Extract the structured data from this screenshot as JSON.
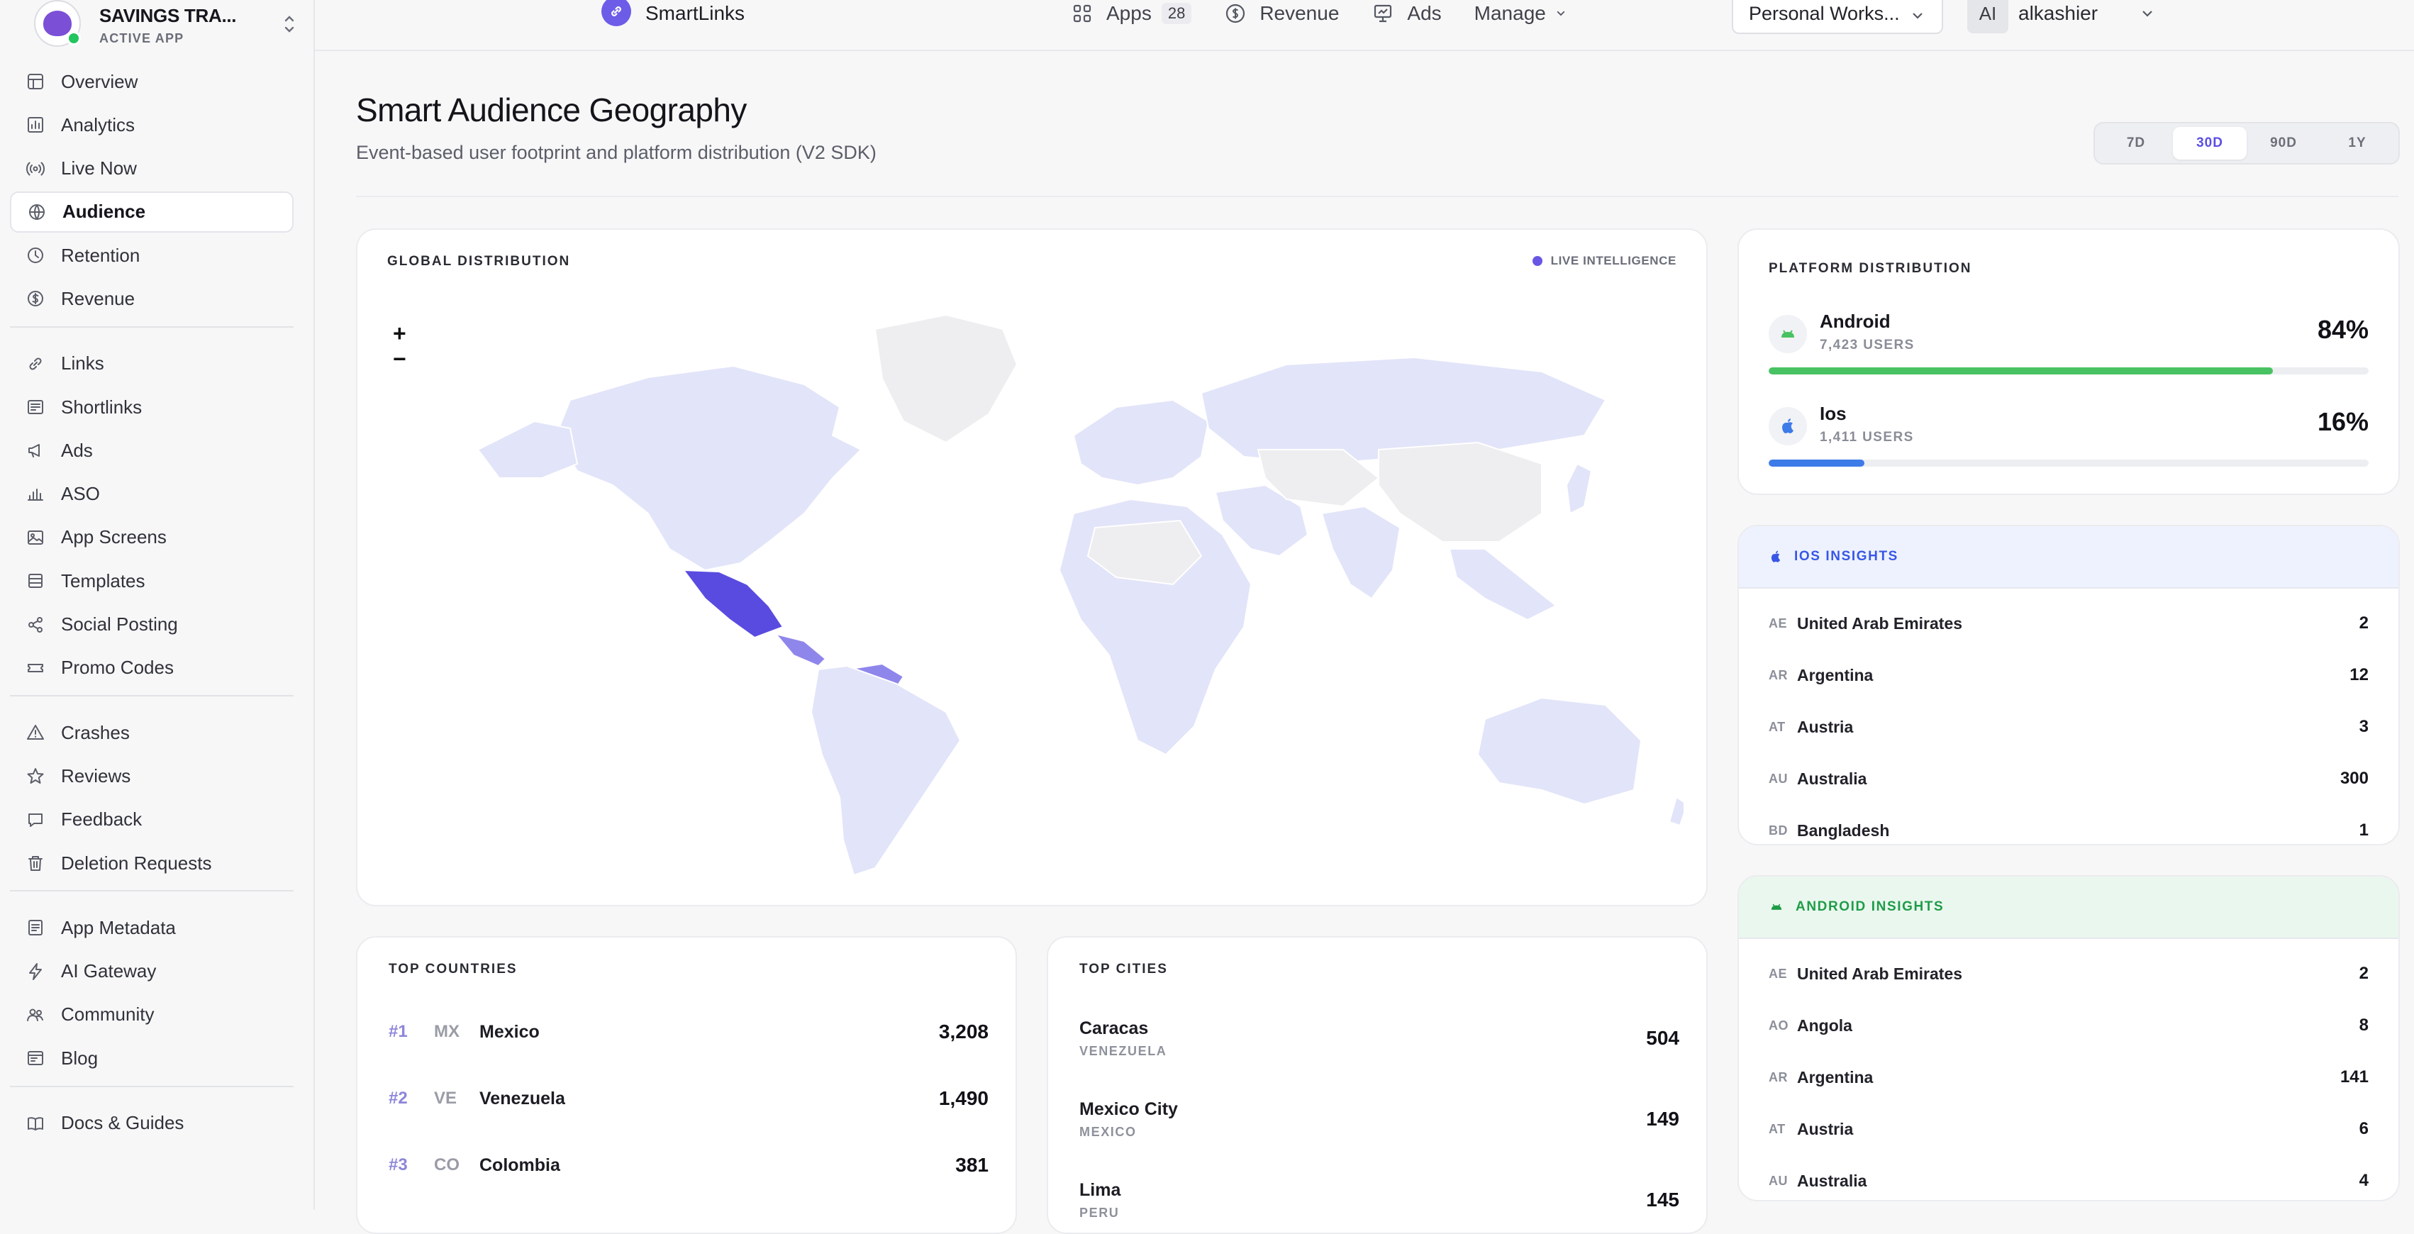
{
  "app": {
    "name": "SAVINGS TRA...",
    "status": "ACTIVE APP"
  },
  "sidebar": {
    "groups": [
      [
        {
          "label": "Overview",
          "icon": "grid-icon"
        },
        {
          "label": "Analytics",
          "icon": "bar-chart-icon"
        },
        {
          "label": "Live Now",
          "icon": "broadcast-icon"
        },
        {
          "label": "Audience",
          "icon": "globe-icon",
          "active": true
        },
        {
          "label": "Retention",
          "icon": "clock-icon"
        },
        {
          "label": "Revenue",
          "icon": "dollar-icon"
        }
      ],
      [
        {
          "label": "Links",
          "icon": "link-icon"
        },
        {
          "label": "Shortlinks",
          "icon": "shortlink-icon"
        },
        {
          "label": "Ads",
          "icon": "megaphone-icon"
        },
        {
          "label": "ASO",
          "icon": "bars-icon"
        },
        {
          "label": "App Screens",
          "icon": "image-icon"
        },
        {
          "label": "Templates",
          "icon": "layers-icon"
        },
        {
          "label": "Social Posting",
          "icon": "share-icon"
        },
        {
          "label": "Promo Codes",
          "icon": "ticket-icon"
        }
      ],
      [
        {
          "label": "Crashes",
          "icon": "warning-icon"
        },
        {
          "label": "Reviews",
          "icon": "star-icon"
        },
        {
          "label": "Feedback",
          "icon": "chat-icon"
        },
        {
          "label": "Deletion Requests",
          "icon": "trash-icon"
        }
      ],
      [
        {
          "label": "App Metadata",
          "icon": "document-icon"
        },
        {
          "label": "AI Gateway",
          "icon": "bolt-icon"
        },
        {
          "label": "Community",
          "icon": "users-icon"
        },
        {
          "label": "Blog",
          "icon": "blog-icon"
        }
      ],
      [
        {
          "label": "Docs & Guides",
          "icon": "book-icon"
        }
      ]
    ]
  },
  "topbar": {
    "brand": "SmartLinks",
    "nav": [
      {
        "label": "Apps",
        "icon": "apps-icon",
        "badge": "28"
      },
      {
        "label": "Revenue",
        "icon": "dollar-icon"
      },
      {
        "label": "Ads",
        "icon": "presentation-icon"
      },
      {
        "label": "Manage",
        "icon": "chevron-down-icon"
      }
    ],
    "workspace": "Personal Works...",
    "user_initials": "AI",
    "user_name": "alkashier"
  },
  "page": {
    "title": "Smart Audience Geography",
    "subtitle": "Event-based user footprint and platform distribution (V2 SDK)",
    "ranges": [
      "7D",
      "30D",
      "90D",
      "1Y"
    ],
    "active_range": "30D"
  },
  "map": {
    "label": "GLOBAL DISTRIBUTION",
    "live_label": "LIVE INTELLIGENCE",
    "zoom_in": "+",
    "zoom_out": "−",
    "colors": {
      "base": "#e2e4f9",
      "none": "#eeeef0",
      "high": "#5a4be0",
      "mid": "#8f86ec"
    }
  },
  "platform": {
    "label": "PLATFORM DISTRIBUTION",
    "items": [
      {
        "name": "Android",
        "users": "7,423 USERS",
        "pct": "84%",
        "share": 0.84,
        "color": "#48c262"
      },
      {
        "name": "Ios",
        "users": "1,411 USERS",
        "pct": "16%",
        "share": 0.16,
        "color": "#3d7be8"
      }
    ]
  },
  "ios_insights": {
    "title": "IOS INSIGHTS",
    "rows": [
      {
        "code": "AE",
        "name": "United Arab Emirates",
        "value": "2"
      },
      {
        "code": "AR",
        "name": "Argentina",
        "value": "12"
      },
      {
        "code": "AT",
        "name": "Austria",
        "value": "3"
      },
      {
        "code": "AU",
        "name": "Australia",
        "value": "300"
      },
      {
        "code": "BD",
        "name": "Bangladesh",
        "value": "1"
      }
    ]
  },
  "android_insights": {
    "title": "ANDROID INSIGHTS",
    "rows": [
      {
        "code": "AE",
        "name": "United Arab Emirates",
        "value": "2"
      },
      {
        "code": "AO",
        "name": "Angola",
        "value": "8"
      },
      {
        "code": "AR",
        "name": "Argentina",
        "value": "141"
      },
      {
        "code": "AT",
        "name": "Austria",
        "value": "6"
      },
      {
        "code": "AU",
        "name": "Australia",
        "value": "4"
      }
    ]
  },
  "top_countries": {
    "label": "TOP COUNTRIES",
    "rows": [
      {
        "rank": "#1",
        "code": "MX",
        "name": "Mexico",
        "value": "3,208"
      },
      {
        "rank": "#2",
        "code": "VE",
        "name": "Venezuela",
        "value": "1,490"
      },
      {
        "rank": "#3",
        "code": "CO",
        "name": "Colombia",
        "value": "381"
      }
    ]
  },
  "top_cities": {
    "label": "TOP CITIES",
    "rows": [
      {
        "name": "Caracas",
        "country": "VENEZUELA",
        "value": "504"
      },
      {
        "name": "Mexico City",
        "country": "MEXICO",
        "value": "149"
      },
      {
        "name": "Lima",
        "country": "PERU",
        "value": "145"
      }
    ]
  }
}
